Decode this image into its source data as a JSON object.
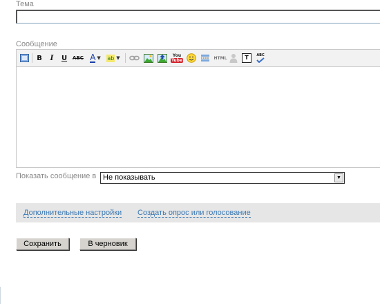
{
  "form": {
    "subject_label": "Тема",
    "subject_value": "",
    "message_label": "Сообщение",
    "show_label": "Показать сообщение в",
    "show_select": {
      "selected": "Не показывать"
    },
    "extra_settings_link": "Дополнительные настройки",
    "create_poll_link": "Создать опрос или голосование",
    "save_button": "Сохранить",
    "draft_button": "В черновик"
  },
  "toolbar": {
    "bold": "B",
    "italic": "I",
    "underline": "U",
    "strike": "ABC",
    "font_color": "A",
    "highlight": "ab",
    "youtube": "You",
    "html": "HTML",
    "typograph": "T",
    "spellcheck": "ABC",
    "icons": [
      "source-toggle-icon",
      "bold-icon",
      "italic-icon",
      "underline-icon",
      "strikethrough-icon",
      "font-color-icon",
      "highlight-color-icon",
      "link-icon",
      "image-icon",
      "image-upload-icon",
      "youtube-icon",
      "smiley-icon",
      "insert-cut-icon",
      "html-icon",
      "user-icon",
      "typograph-icon",
      "spellcheck-icon"
    ]
  }
}
